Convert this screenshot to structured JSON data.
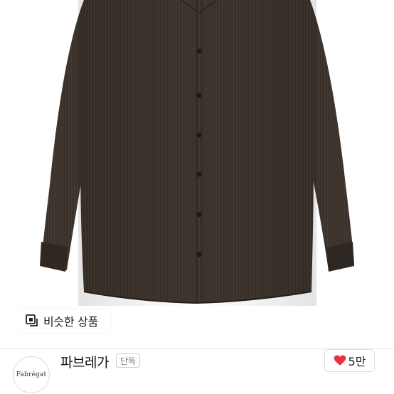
{
  "product": {
    "image_icon": "brown-dress-shirt-photo",
    "shirt_color": "#3a322b"
  },
  "similar_button": {
    "label": "비슷한 상품",
    "icon": "similar-items-icon"
  },
  "shop": {
    "logo_text": "Fabrégat",
    "name": "파브레가",
    "badge": "단독"
  },
  "like": {
    "count": "5만",
    "icon": "heart-icon",
    "color": "#e8323c"
  }
}
